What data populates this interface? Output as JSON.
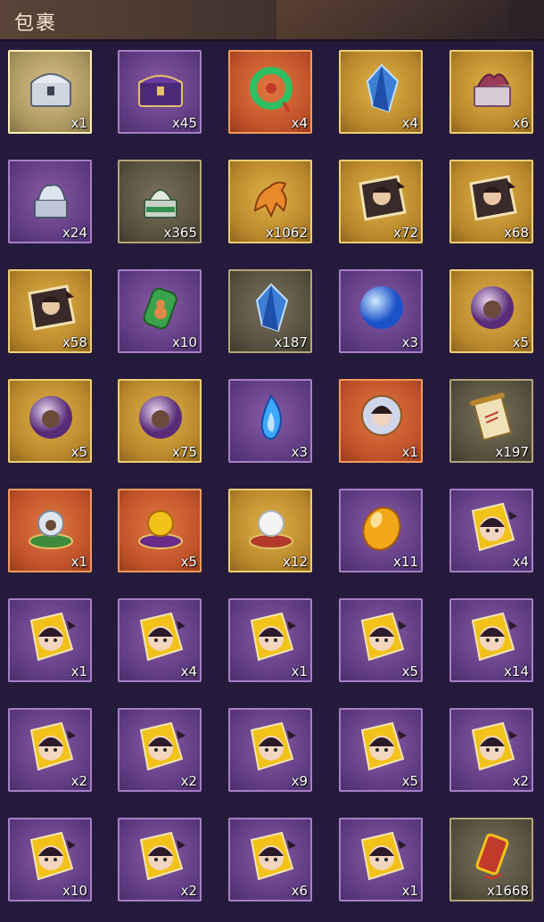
{
  "header": {
    "title": "包裹"
  },
  "items": [
    {
      "count": "x1",
      "icon": "silver-chest-icon",
      "frame": "silver"
    },
    {
      "count": "x45",
      "icon": "purple-chest-icon",
      "frame": "purple"
    },
    {
      "count": "x4",
      "icon": "jade-ornament-icon",
      "frame": "orange"
    },
    {
      "count": "x4",
      "icon": "blue-crystal-icon",
      "frame": "gold"
    },
    {
      "count": "x6",
      "icon": "dragon-box-icon",
      "frame": "gold"
    },
    {
      "count": "x24",
      "icon": "silver-seal-icon",
      "frame": "purple"
    },
    {
      "count": "x365",
      "icon": "jade-seal-icon",
      "frame": "gray"
    },
    {
      "count": "x1062",
      "icon": "horse-token-icon",
      "frame": "gold"
    },
    {
      "count": "x72",
      "icon": "hero-portrait-icon",
      "frame": "gold"
    },
    {
      "count": "x68",
      "icon": "hero-portrait-icon",
      "frame": "gold"
    },
    {
      "count": "x58",
      "icon": "hero-portrait-icon",
      "frame": "gold"
    },
    {
      "count": "x10",
      "icon": "gourd-charm-icon",
      "frame": "purple"
    },
    {
      "count": "x187",
      "icon": "blue-crystal-icon",
      "frame": "gray"
    },
    {
      "count": "x3",
      "icon": "blue-orb-icon",
      "frame": "purple"
    },
    {
      "count": "x5",
      "icon": "spirit-orb-icon",
      "frame": "gold"
    },
    {
      "count": "x5",
      "icon": "spirit-orb-icon",
      "frame": "gold"
    },
    {
      "count": "x75",
      "icon": "spirit-orb-icon",
      "frame": "gold"
    },
    {
      "count": "x3",
      "icon": "blue-flame-icon",
      "frame": "purple"
    },
    {
      "count": "x1",
      "icon": "lady-orb-icon",
      "frame": "orange"
    },
    {
      "count": "x197",
      "icon": "scroll-icon",
      "frame": "gray"
    },
    {
      "count": "x1",
      "icon": "pearl-pedestal-icon",
      "frame": "orange"
    },
    {
      "count": "x5",
      "icon": "gold-pearl-pedestal-icon",
      "frame": "orange"
    },
    {
      "count": "x12",
      "icon": "white-pearl-pedestal-icon",
      "frame": "gold"
    },
    {
      "count": "x11",
      "icon": "golden-egg-icon",
      "frame": "purple"
    },
    {
      "count": "x4",
      "icon": "chibi-hero-icon",
      "frame": "purple"
    },
    {
      "count": "x1",
      "icon": "chibi-hero-icon",
      "frame": "purple"
    },
    {
      "count": "x4",
      "icon": "chibi-hero-icon",
      "frame": "purple"
    },
    {
      "count": "x1",
      "icon": "chibi-hero-icon",
      "frame": "purple"
    },
    {
      "count": "x5",
      "icon": "chibi-hero-icon",
      "frame": "purple"
    },
    {
      "count": "x14",
      "icon": "chibi-hero-icon",
      "frame": "purple"
    },
    {
      "count": "x2",
      "icon": "chibi-hero-icon",
      "frame": "purple"
    },
    {
      "count": "x2",
      "icon": "chibi-hero-icon",
      "frame": "purple"
    },
    {
      "count": "x9",
      "icon": "chibi-hero-icon",
      "frame": "purple"
    },
    {
      "count": "x5",
      "icon": "chibi-hero-icon",
      "frame": "purple"
    },
    {
      "count": "x2",
      "icon": "chibi-hero-icon",
      "frame": "purple"
    },
    {
      "count": "x10",
      "icon": "chibi-hero-icon",
      "frame": "purple"
    },
    {
      "count": "x2",
      "icon": "chibi-hero-icon",
      "frame": "purple"
    },
    {
      "count": "x6",
      "icon": "chibi-hero-icon",
      "frame": "purple"
    },
    {
      "count": "x1",
      "icon": "chibi-hero-icon",
      "frame": "purple"
    },
    {
      "count": "x1668",
      "icon": "red-gold-token-icon",
      "frame": "gray"
    }
  ]
}
